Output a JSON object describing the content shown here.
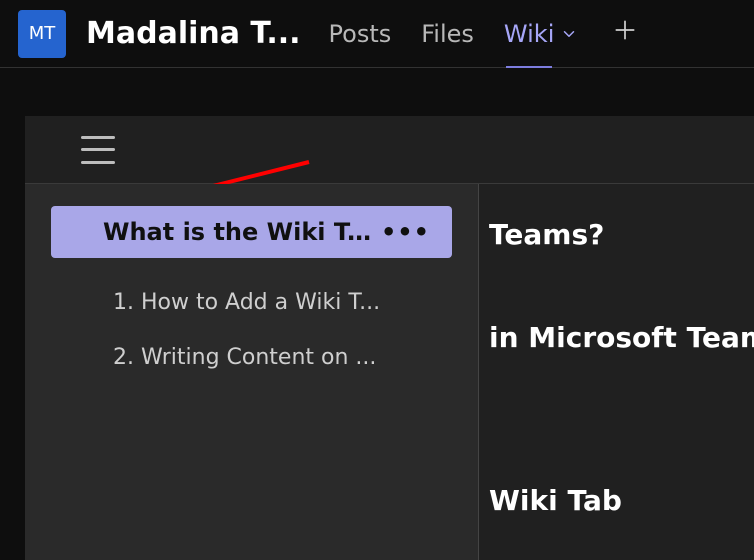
{
  "header": {
    "avatar_initials": "MT",
    "channel_name": "Madalina T...",
    "tabs": {
      "posts": "Posts",
      "files": "Files",
      "wiki": "Wiki",
      "active": "wiki"
    }
  },
  "wiki_nav": {
    "current_page": "What is the Wiki Ta...",
    "sections": [
      "1. How to Add a Wiki T...",
      "2. Writing Content on ..."
    ]
  },
  "wiki_page": {
    "title_fragment": "Teams?",
    "subtitle_fragment": "in Microsoft Teams",
    "section_fragment": "Wiki Tab"
  }
}
